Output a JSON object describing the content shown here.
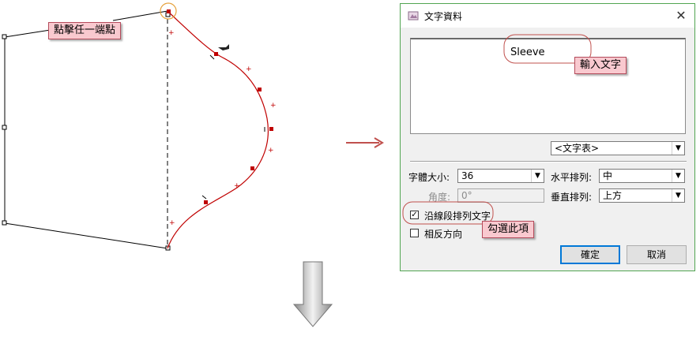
{
  "annotations": {
    "click_endpoint": "點擊任一端點",
    "enter_text": "輸入文字",
    "check_this": "勾選此項"
  },
  "dialog": {
    "title": "文字資料",
    "text_value": "Sleeve",
    "text_table_option": "<文字表>",
    "font_size_label": "字體大小:",
    "font_size_value": "36",
    "angle_label": "角度:",
    "angle_value": "0°",
    "h_align_label": "水平排列:",
    "h_align_value": "中",
    "v_align_label": "垂直排列:",
    "v_align_value": "上方",
    "along_segment_label": "沿線段排列文字",
    "along_segment_checked": true,
    "reverse_label": "相反方向",
    "reverse_checked": false,
    "ok_label": "確定",
    "cancel_label": "取消"
  },
  "colors": {
    "curve": "#c00000",
    "callout_bg": "#f9c9cf",
    "callout_border": "#b44b5b",
    "dialog_border": "#52a552",
    "arrow_right": "#c0504d",
    "highlight_ring": "#e6a23c"
  },
  "icons": {
    "cursor": "cursor-icon",
    "app": "app-icon",
    "close": "close-icon",
    "arrow_right": "arrow-right-icon",
    "arrow_down": "arrow-down-icon"
  }
}
